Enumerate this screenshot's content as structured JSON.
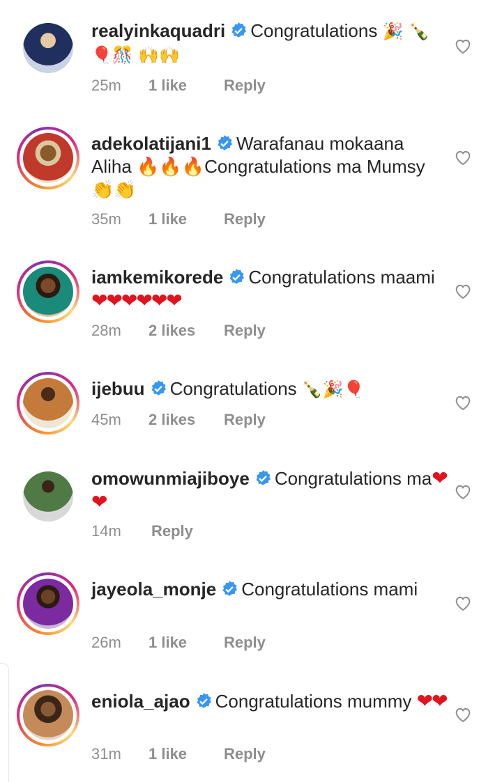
{
  "comments": [
    {
      "username": "realyinkaquadri",
      "text": "Congratulations",
      "emoji": "🎉 🍾🎈🎊 🙌🙌",
      "time": "25m",
      "likes": "1 like",
      "reply": "Reply",
      "ring": false,
      "avatar_color": "#2d3b6b"
    },
    {
      "username": "adekolatijani1",
      "text": "Warafanau mokaana Aliha 🔥🔥🔥Congratulations ma Mumsy 👏👏",
      "emoji": "",
      "time": "35m",
      "likes": "1 like",
      "reply": "Reply",
      "ring": true,
      "avatar_color": "#c0392b"
    },
    {
      "username": "iamkemikorede",
      "text": "Congratulations maami",
      "emoji": "❤❤❤❤❤❤",
      "time": "28m",
      "likes": "2 likes",
      "reply": "Reply",
      "ring": true,
      "avatar_color": "#1a7a6e"
    },
    {
      "username": "ijebuu",
      "text": "Congratulations",
      "emoji": "🍾🎉🎈",
      "time": "45m",
      "likes": "2 likes",
      "reply": "Reply",
      "ring": true,
      "avatar_color": "#b5651d"
    },
    {
      "username": "omowunmiajiboye",
      "text": "Congratulations ma",
      "emoji": "❤❤",
      "time": "14m",
      "likes": "",
      "reply": "Reply",
      "ring": false,
      "avatar_color": "#2e4d2e"
    },
    {
      "username": "jayeola_monje",
      "text": "Congratulations mami",
      "emoji": "",
      "time": "26m",
      "likes": "1 like",
      "reply": "Reply",
      "ring": true,
      "avatar_color": "#6a1b9a"
    },
    {
      "username": "eniola_ajao",
      "text": "Congratulations mummy",
      "emoji": "❤❤",
      "time": "31m",
      "likes": "1 like",
      "reply": "Reply",
      "ring": true,
      "avatar_color": "#5d3a1a"
    }
  ],
  "colors": {
    "verified": "#3897f0",
    "meta": "#8e8e8e",
    "heart_red": "#e0141e"
  }
}
